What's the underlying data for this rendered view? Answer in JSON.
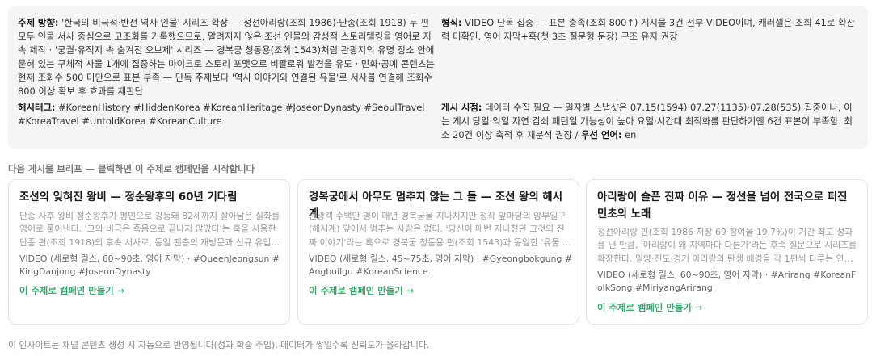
{
  "insights": {
    "topic": {
      "label": "주제 방향:",
      "text": "'한국의 비극적·반전 역사 인물' 시리즈 확장 — 정선아리랑(조회 1986)·단종(조회 1918) 두 편 모두 인물 서사 중심으로 고조회를 기록했으므로, 알려지지 않은 조선 인물의 감성적 스토리텔링을 영어로 지속 제작 · '궁궐·유적지 속 숨겨진 오브제' 시리즈 — 경복궁 청동용(조회 1543)처럼 관광지의 유명 장소 안에 묻혀 있는 구체적 사물 1개에 집중하는 마이크로 스토리 포맷으로 비팔로워 발견을 유도 · 민화·공예 콘텐츠는 현재 조회수 500 미만으로 표본 부족 — 단독 주제보다 '역사 이야기와 연결된 유물'로 서사를 연결해 조회수 800 이상 확보 후 효과를 재판단"
    },
    "format": {
      "label": "형식:",
      "text": "VIDEO 단독 집중 — 표본 충족(조회 800↑) 게시물 3건 전부 VIDEO이며, 캐러셀은 조회 41로 확산력 미확인. 영어 자막+훅(첫 3초 질문형 문장) 구조 유지 권장"
    },
    "hashtags": {
      "label": "해시태그:",
      "text": "#KoreanHistory #HiddenKorea #KoreanHeritage #JoseonDynasty #SeoulTravel #KoreaTravel #UntoldKorea #KoreanCulture"
    },
    "timing": {
      "label": "게시 시점:",
      "text": "데이터 수집 필요 — 일자별 스냅샷은 07.15(1594)·07.27(1135)·07.28(535) 집중이나, 이는 게시 당일·익일 자연 감쇠 패턴일 가능성이 높아 요일·시간대 최적화를 판단하기엔 6건 표본이 부족함. 최소 20건 이상 축적 후 재분석 권장 /",
      "lang_label": "우선 언어:",
      "lang_value": "en"
    }
  },
  "brief_heading": "다음 게시물 브리프 — 클릭하면 이 주제로 캠페인을 시작합니다",
  "cards": [
    {
      "title": "조선의 잊혀진 왕비 — 정순왕후의 60년 기다림",
      "desc": "단종 사후 왕비 정순왕후가 평민으로 강등돼 82세까지 살아남은 실화를 영어로 풀어낸다. '그의 비극은 죽음으로 끝나지 않았다'는 훅을 사용한 단종 편(조회 1918)의 후속 서사로, 동일 팬층의 재방문과 신규 유입을 노린다",
      "meta": "VIDEO (세로형 릴스, 60~90초, 영어 자막) · #QueenJeongsun #KingDanjong #JoseonDynasty",
      "cta": "이 주제로 캠페인 만들기 →"
    },
    {
      "title": "경복궁에서 아무도 멈추지 않는 그 돌 — 조선 왕의 해시계",
      "desc": "관광객 수백만 명이 매년 경복궁을 지나치지만 정작 앞마당의 앙부일구(해시계) 앞에서 멈추는 사람은 없다. '당신이 매번 지나쳤던 그것의 진짜 이야기'라는 훅으로 경복궁 청동용 편(조회 1543)과 동일한 '유물 발견' 포맷을 재현한다",
      "meta": "VIDEO (세로형 릴스, 45~75초, 영어 자막) · #Gyeongbokgung #Angbuilgu #KoreanScience",
      "cta": "이 주제로 캠페인 만들기 →"
    },
    {
      "title": "아리랑이 슬픈 진짜 이유 — 정선을 넘어 전국으로 퍼진 민초의 노래",
      "desc": "정선아리랑 편(조회 1986·저장 69·참여율 19.7%)이 기간 최고 성과를 낸 만큼, '아리랑이 왜 지역마다 다른가'라는 후속 질문으로 시리즈를 확장한다. 밀양·진도·경기 아리랑의 탄생 배경을 각 1편씩 다루는 연작으로 구성한다",
      "meta": "VIDEO (세로형 릴스, 60~90초, 영어 자막) · #Arirang #KoreanFolkSong #MiriyangArirang",
      "cta": "이 주제로 캠페인 만들기 →"
    }
  ],
  "footer_note": "이 인사이트는 채널 콘텐츠 생성 시 자동으로 반영됩니다(성과 학습 주입). 데이터가 쌓일수록 신뢰도가 올라갑니다."
}
